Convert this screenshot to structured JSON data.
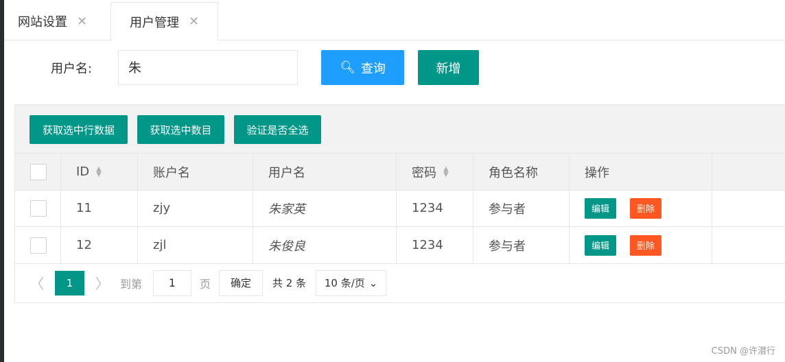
{
  "tabs": [
    {
      "label": "网站设置"
    },
    {
      "label": "用户管理"
    }
  ],
  "search": {
    "label": "用户名:",
    "value": "朱",
    "query_label": "查询",
    "add_label": "新增"
  },
  "toolbar": [
    "获取选中行数据",
    "获取选中数目",
    "验证是否全选"
  ],
  "columns": [
    "ID",
    "账户名",
    "用户名",
    "密码",
    "角色名称",
    "操作"
  ],
  "rows": [
    {
      "id": "11",
      "account": "zjy",
      "name": "朱家英",
      "password": "1234",
      "role": "参与者"
    },
    {
      "id": "12",
      "account": "zjl",
      "name": "朱俊良",
      "password": "1234",
      "role": "参与者"
    }
  ],
  "actions": {
    "edit": "编辑",
    "delete": "删除"
  },
  "pager": {
    "current": "1",
    "goto": "到第",
    "page_input": "1",
    "page_unit": "页",
    "confirm": "确定",
    "total": "共 2 条",
    "page_size": "10 条/页"
  },
  "watermark": "CSDN @许潜行",
  "colors": {
    "primary": "#009688",
    "blue": "#1E9FFF",
    "danger": "#FF5722"
  }
}
